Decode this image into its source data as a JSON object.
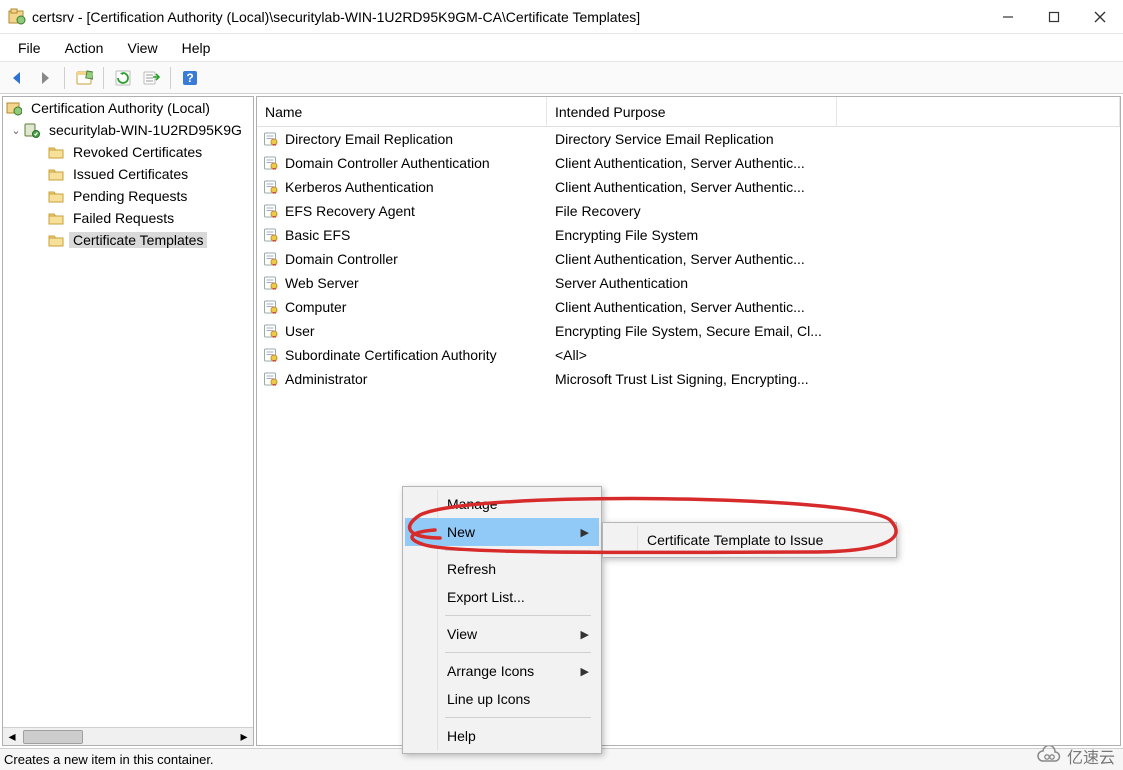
{
  "window": {
    "title": "certsrv - [Certification Authority (Local)\\securitylab-WIN-1U2RD95K9GM-CA\\Certificate Templates]"
  },
  "menu": {
    "file": "File",
    "action": "Action",
    "view": "View",
    "help": "Help"
  },
  "toolbar_icons": {
    "back": "back-icon",
    "forward": "forward-icon",
    "up": "up-icon",
    "refresh": "refresh-icon",
    "export": "export-icon",
    "help": "help-icon"
  },
  "tree": {
    "root": "Certification Authority (Local)",
    "ca": "securitylab-WIN-1U2RD95K9G",
    "nodes": [
      "Revoked Certificates",
      "Issued Certificates",
      "Pending Requests",
      "Failed Requests",
      "Certificate Templates"
    ],
    "selected_index": 4
  },
  "list": {
    "columns": {
      "name": "Name",
      "purpose": "Intended Purpose"
    },
    "rows": [
      {
        "name": "Directory Email Replication",
        "purpose": "Directory Service Email Replication"
      },
      {
        "name": "Domain Controller Authentication",
        "purpose": "Client Authentication, Server Authentic..."
      },
      {
        "name": "Kerberos Authentication",
        "purpose": "Client Authentication, Server Authentic..."
      },
      {
        "name": "EFS Recovery Agent",
        "purpose": "File Recovery"
      },
      {
        "name": "Basic EFS",
        "purpose": "Encrypting File System"
      },
      {
        "name": "Domain Controller",
        "purpose": "Client Authentication, Server Authentic..."
      },
      {
        "name": "Web Server",
        "purpose": "Server Authentication"
      },
      {
        "name": "Computer",
        "purpose": "Client Authentication, Server Authentic..."
      },
      {
        "name": "User",
        "purpose": "Encrypting File System, Secure Email, Cl..."
      },
      {
        "name": "Subordinate Certification Authority",
        "purpose": "<All>"
      },
      {
        "name": "Administrator",
        "purpose": "Microsoft Trust List Signing, Encrypting..."
      }
    ]
  },
  "context_menu": {
    "items": [
      {
        "label": "Manage",
        "submenu": false
      },
      {
        "label": "New",
        "submenu": true,
        "hover": true
      },
      {
        "sep": true
      },
      {
        "label": "Refresh",
        "submenu": false
      },
      {
        "label": "Export List...",
        "submenu": false
      },
      {
        "sep": true
      },
      {
        "label": "View",
        "submenu": true
      },
      {
        "sep": true
      },
      {
        "label": "Arrange Icons",
        "submenu": true
      },
      {
        "label": "Line up Icons",
        "submenu": false
      },
      {
        "sep": true
      },
      {
        "label": "Help",
        "submenu": false
      }
    ],
    "submenu": {
      "items": [
        "Certificate Template to Issue"
      ]
    }
  },
  "statusbar": {
    "text": "Creates a new item in this container."
  },
  "watermark": {
    "text": "亿速云"
  }
}
